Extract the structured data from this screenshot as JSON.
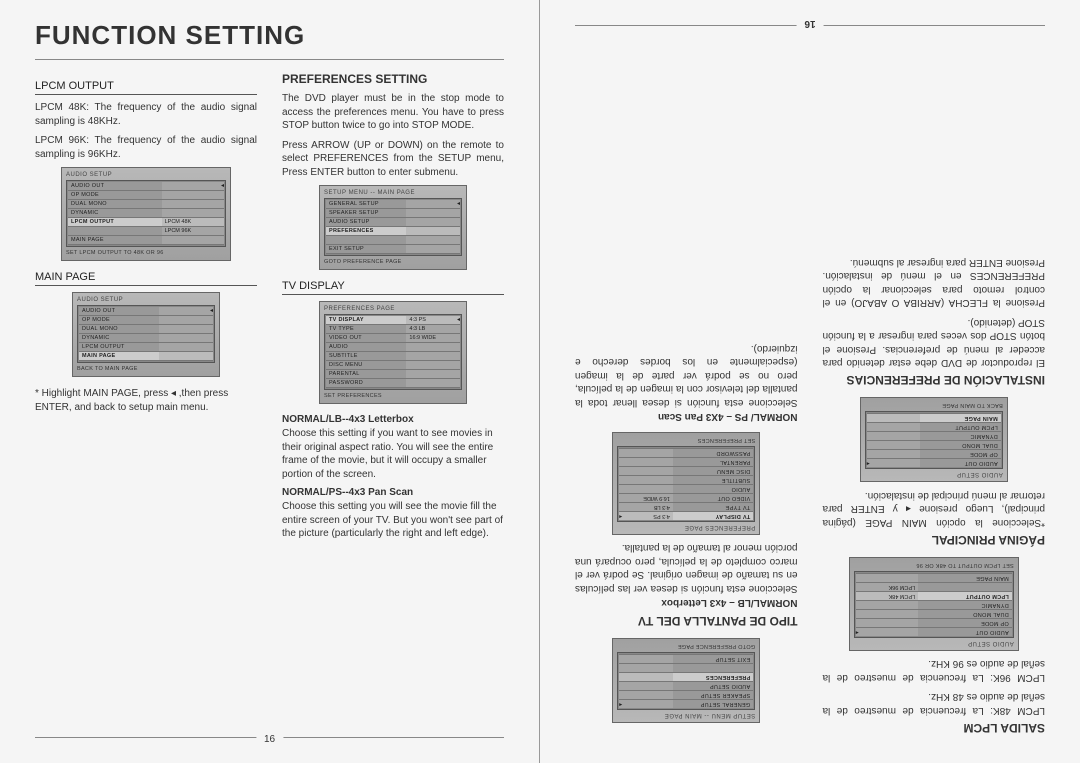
{
  "left": {
    "page_title": "FUNCTION SETTING",
    "col1": {
      "hdr_lpcm": "LPCM OUTPUT",
      "lpcm48": "LPCM 48K: The frequency of the audio signal sampling is 48KHz.",
      "lpcm96": "LPCM 96K: The frequency of the audio signal sampling is 96KHz.",
      "menu1": {
        "title": "AUDIO SETUP",
        "rows": [
          {
            "l": "AUDIO OUT",
            "r": ""
          },
          {
            "l": "OP MODE",
            "r": ""
          },
          {
            "l": "DUAL MONO",
            "r": ""
          },
          {
            "l": "DYNAMIC",
            "r": ""
          },
          {
            "l": "LPCM OUTPUT",
            "r": "LPCM 48K",
            "sel": true
          },
          {
            "l": "",
            "r": "LPCM 96K"
          },
          {
            "l": "MAIN PAGE",
            "r": ""
          }
        ],
        "footer": "SET LPCM OUTPUT TO 48K OR 96"
      },
      "hdr_main": "MAIN PAGE",
      "menu2": {
        "title": "AUDIO SETUP",
        "rows": [
          {
            "l": "AUDIO OUT",
            "r": ""
          },
          {
            "l": "OP MODE",
            "r": ""
          },
          {
            "l": "DUAL MONO",
            "r": ""
          },
          {
            "l": "DYNAMIC",
            "r": ""
          },
          {
            "l": "LPCM OUTPUT",
            "r": ""
          },
          {
            "l": "MAIN PAGE",
            "r": "",
            "sel": true
          }
        ],
        "footer": "BACK TO MAIN PAGE"
      },
      "main_note": "* Highlight MAIN PAGE, press ◂ ,then press ENTER, and back to setup main menu."
    },
    "col2": {
      "hdr_pref": "PREFERENCES SETTING",
      "pref_p1": "The DVD player must be in the stop mode to access the preferences menu. You have to press STOP button twice to go into STOP MODE.",
      "pref_p2": "Press ARROW (UP or DOWN) on the remote to select PREFERENCES from the SETUP menu, Press ENTER button to enter submenu.",
      "menu3": {
        "title": "SETUP MENU -- MAIN PAGE",
        "rows": [
          {
            "l": "GENERAL SETUP",
            "r": ""
          },
          {
            "l": "SPEAKER SETUP",
            "r": ""
          },
          {
            "l": "AUDIO SETUP",
            "r": ""
          },
          {
            "l": "PREFERENCES",
            "r": "",
            "sel": true
          },
          {
            "l": "",
            "r": ""
          },
          {
            "l": "EXIT SETUP",
            "r": ""
          }
        ],
        "footer": "GOTO PREFERENCE PAGE"
      },
      "hdr_tv": "TV DISPLAY",
      "menu4": {
        "title": "PREFERENCES PAGE",
        "rows": [
          {
            "l": "TV DISPLAY",
            "r": "4:3 PS",
            "sel": true
          },
          {
            "l": "TV TYPE",
            "r": "4:3 LB"
          },
          {
            "l": "VIDEO OUT",
            "r": "16:9 WIDE"
          },
          {
            "l": "AUDIO",
            "r": ""
          },
          {
            "l": "SUBTITLE",
            "r": ""
          },
          {
            "l": "DISC MENU",
            "r": ""
          },
          {
            "l": "PARENTAL",
            "r": ""
          },
          {
            "l": "PASSWORD",
            "r": ""
          }
        ],
        "footer": "SET PREFERENCES"
      },
      "lb_hdr": "NORMAL/LB--4x3 Letterbox",
      "lb_p": "Choose this setting if you want to see movies in their original aspect ratio. You will see the entire frame of the movie, but it will occupy a smaller portion of the screen.",
      "ps_hdr": "NORMAL/PS--4x3 Pan Scan",
      "ps_p": "Choose this setting you will see the movie fill the entire screen of your TV. But you won't see part of the picture (particularly the right and left edge)."
    },
    "page_num": "16"
  },
  "right": {
    "hdr_salida": "SALIDA LPCM",
    "salida_48": "LPCM 48K: La frecuencia de muestreo de la señal de audio es 48 KHz.",
    "salida_96": "LPCM 96K: La frecuencia de muestreo de la señal de audio es 96 KHz.",
    "menuA": {
      "title": "AUDIO SETUP",
      "rows": [
        {
          "l": "AUDIO OUT",
          "r": ""
        },
        {
          "l": "OP MODE",
          "r": ""
        },
        {
          "l": "DUAL MONO",
          "r": ""
        },
        {
          "l": "DYNAMIC",
          "r": ""
        },
        {
          "l": "LPCM OUTPUT",
          "r": "LPCM 48K",
          "sel": true
        },
        {
          "l": "",
          "r": "LPCM 96K"
        },
        {
          "l": "MAIN PAGE",
          "r": ""
        }
      ],
      "footer": "SET LPCM OUTPUT TO 48K OR 96"
    },
    "hdr_pagina": "PÁGINA PRINCIPAL",
    "pagina_p": "*Seleccione la opción MAIN PAGE (página principal), Luego presione ◂ y ENTER para retornar al menú principal de instalación.",
    "menuB": {
      "title": "AUDIO SETUP",
      "rows": [
        {
          "l": "AUDIO OUT",
          "r": ""
        },
        {
          "l": "OP MODE",
          "r": ""
        },
        {
          "l": "DUAL MONO",
          "r": ""
        },
        {
          "l": "DYNAMIC",
          "r": ""
        },
        {
          "l": "LPCM OUTPUT",
          "r": ""
        },
        {
          "l": "MAIN PAGE",
          "r": "",
          "sel": true
        }
      ],
      "footer": "BACK TO MAIN PAGE"
    },
    "hdr_inst": "INSTALACIÓN DE PREFERENCIAS",
    "inst_p1": "El reproductor de DVD debe estar detenido para acceder al menú de preferencias. Presione el botón STOP dos veces para ingresar a la función STOP (detenido).",
    "inst_p2": "Presione la FLECHA (ARRIBA O ABAJO) en el control remoto para seleccionar la opción PREFERENCES en el menú de instalación. Presione ENTER para ingresar al submenú.",
    "menuC": {
      "title": "SETUP MENU -- MAIN PAGE",
      "rows": [
        {
          "l": "GENERAL SETUP",
          "r": ""
        },
        {
          "l": "SPEAKER SETUP",
          "r": ""
        },
        {
          "l": "AUDIO SETUP",
          "r": ""
        },
        {
          "l": "PREFERENCES",
          "r": "",
          "sel": true
        },
        {
          "l": "",
          "r": ""
        },
        {
          "l": "EXIT SETUP",
          "r": ""
        }
      ],
      "footer": "GOTO PREFERENCE PAGE"
    },
    "hdr_tipo": "TIPO DE PANTALLA DEL TV",
    "lb_hdr_es": "NORMAL/LB – 4x3 Letterbox",
    "lb_p_es": "Seleccione esta función si desea ver las películas en su tamaño de imagen original. Se podrá ver el marco completo de la película, pero ocupará una porción menor al tamaño de la pantalla.",
    "menuD": {
      "title": "PREFERENCES PAGE",
      "rows": [
        {
          "l": "TV DISPLAY",
          "r": "4:3 PS",
          "sel": true
        },
        {
          "l": "TV TYPE",
          "r": "4:3 LB"
        },
        {
          "l": "VIDEO OUT",
          "r": "16:9 WIDE"
        },
        {
          "l": "AUDIO",
          "r": ""
        },
        {
          "l": "SUBTITLE",
          "r": ""
        },
        {
          "l": "DISC MENU",
          "r": ""
        },
        {
          "l": "PARENTAL",
          "r": ""
        },
        {
          "l": "PASSWORD",
          "r": ""
        }
      ],
      "footer": "SET PREFERENCES"
    },
    "ps_hdr_es": "NORMAL/ PS – 4X3 Pan Scan",
    "ps_p_es": "Seleccione esta función si desea llenar toda la pantalla del televisor con la imagen de la película, pero no se podrá ver parte de la imagen (especialmente en los bordes derecho e izquierdo).",
    "page_num": "16"
  }
}
